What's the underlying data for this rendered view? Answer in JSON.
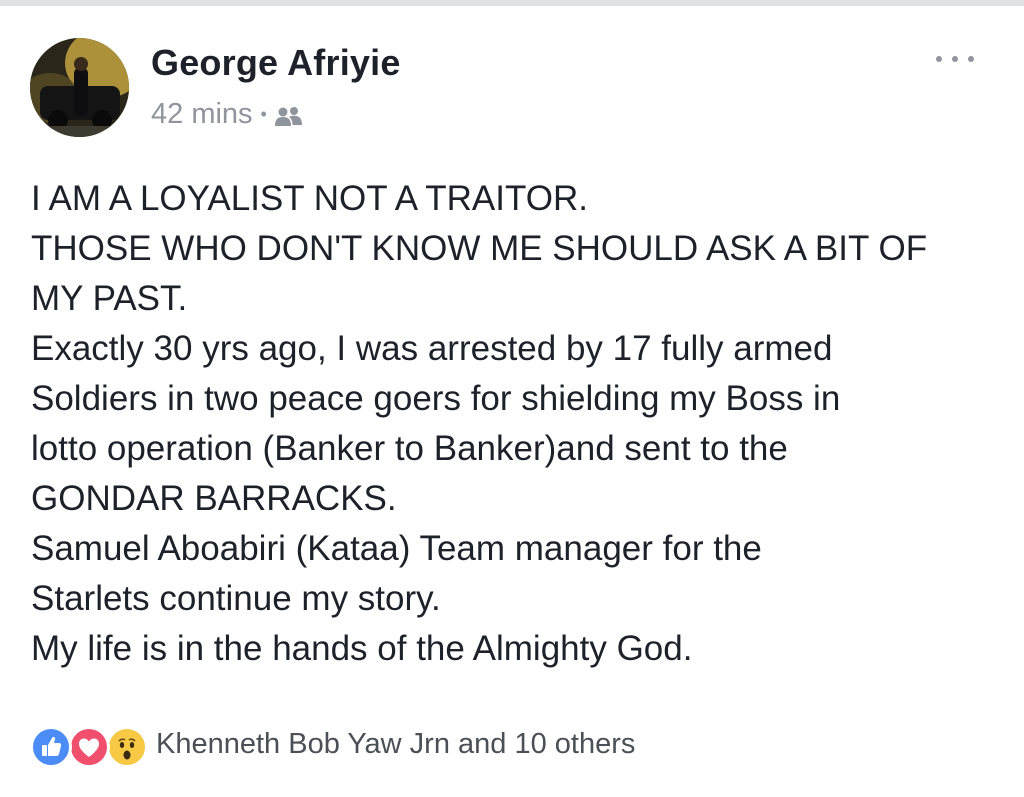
{
  "post": {
    "author": "George Afriyie",
    "timestamp": "42 mins",
    "separator": "•",
    "audience_icon": "friends-icon",
    "more_icon": "more-options-icon",
    "body_lines": [
      "I AM A LOYALIST NOT A TRAITOR.",
      "THOSE WHO DON'T KNOW ME SHOULD ASK A BIT OF",
      "MY PAST.",
      "Exactly 30 yrs ago, I was arrested by 17 fully armed",
      "Soldiers in two peace goers for shielding my Boss in",
      "lotto operation (Banker to Banker)and sent to the",
      "GONDAR BARRACKS.",
      "Samuel Aboabiri (Kataa) Team manager for the",
      "Starlets continue my story.",
      "My life is in the hands of the Almighty God."
    ]
  },
  "reactions": {
    "types": [
      "like-icon",
      "love-icon",
      "wow-icon"
    ],
    "summary": "Khenneth Bob Yaw Jrn and 10 others"
  },
  "colors": {
    "text": "#1d2129",
    "meta": "#90949c",
    "like": "#4b8cf7",
    "love": "#f0506e",
    "wow": "#f7c945"
  }
}
